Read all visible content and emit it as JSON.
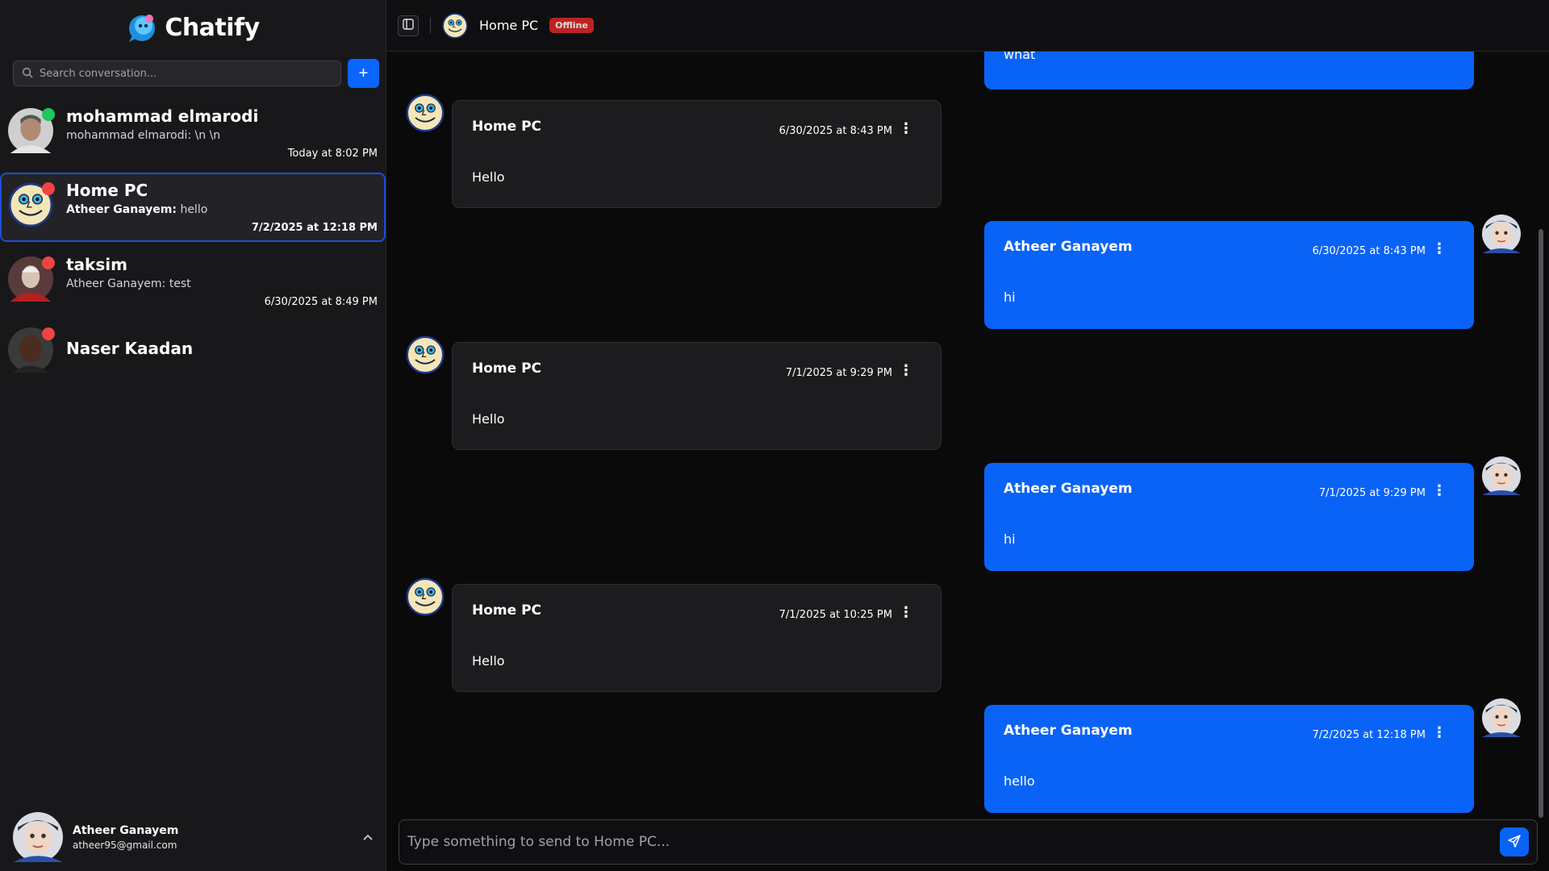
{
  "brand": {
    "name": "Chatify"
  },
  "search": {
    "placeholder": "Search conversation..."
  },
  "new_chat_button": "+",
  "conversations": [
    {
      "name": "mohammad elmarodi",
      "preview_sender": "mohammad elmarodi:",
      "preview_text": " \\n \\n",
      "time": "Today at 8:02 PM",
      "status": "online"
    },
    {
      "name": "Home PC",
      "preview_sender": "Atheer Ganayem:",
      "preview_text": " hello",
      "time": "7/2/2025 at 12:18 PM",
      "status": "offline"
    },
    {
      "name": "taksim",
      "preview_sender": "Atheer Ganayem:",
      "preview_text": " test",
      "time": "6/30/2025 at 8:49 PM",
      "status": "offline"
    },
    {
      "name": "Naser Kaadan",
      "preview_sender": "",
      "preview_text": "",
      "time": "",
      "status": "offline"
    }
  ],
  "current_user": {
    "name": "Atheer Ganayem",
    "email": "atheer95@gmail.com"
  },
  "chat_header": {
    "name": "Home PC",
    "status": "Offline"
  },
  "partial_message": {
    "text": "what"
  },
  "messages": [
    {
      "direction": "in",
      "sender": "Home PC",
      "time": "6/30/2025 at 8:43 PM",
      "text": "Hello"
    },
    {
      "direction": "out",
      "sender": "Atheer Ganayem",
      "time": "6/30/2025 at 8:43 PM",
      "text": "hi"
    },
    {
      "direction": "in",
      "sender": "Home PC",
      "time": "7/1/2025 at 9:29 PM",
      "text": "Hello"
    },
    {
      "direction": "out",
      "sender": "Atheer Ganayem",
      "time": "7/1/2025 at 9:29 PM",
      "text": "hi"
    },
    {
      "direction": "in",
      "sender": "Home PC",
      "time": "7/1/2025 at 10:25 PM",
      "text": "Hello"
    },
    {
      "direction": "out",
      "sender": "Atheer Ganayem",
      "time": "7/2/2025 at 12:18 PM",
      "text": "hello"
    }
  ],
  "composer": {
    "placeholder": "Type something to send to Home PC..."
  },
  "colors": {
    "accent": "#0a63f7",
    "online": "#22c55e",
    "offline": "#ef4444",
    "badge": "#dc2626"
  }
}
